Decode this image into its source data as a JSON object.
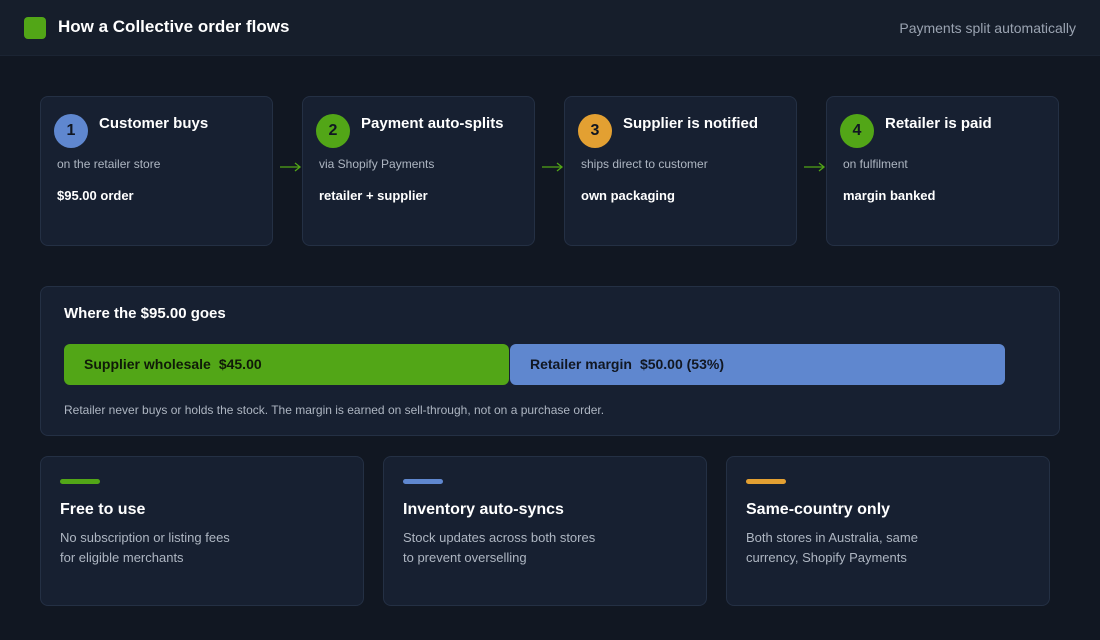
{
  "header": {
    "title": "How a Collective order flows",
    "note": "Payments split automatically",
    "brand_color": "#52a617"
  },
  "steps": [
    {
      "number": "1",
      "title": "Customer buys",
      "subtitle": "on the retailer store",
      "value": "$95.00 order",
      "color": "#5f87cf",
      "number_color": "#111722"
    },
    {
      "number": "2",
      "title": "Payment auto-splits",
      "subtitle": "via Shopify Payments",
      "value": "retailer + supplier",
      "color": "#52a617",
      "number_color": "#111722"
    },
    {
      "number": "3",
      "title": "Supplier is notified",
      "subtitle": "ships direct to customer",
      "value": "own packaging",
      "color": "#e3a032",
      "number_color": "#111722"
    },
    {
      "number": "4",
      "title": "Retailer is paid",
      "subtitle": "on fulfilment",
      "value": "margin banked",
      "color": "#52a617",
      "number_color": "#111722"
    }
  ],
  "arrow_icon": "arrow-right-icon",
  "split": {
    "title": "Where the $95.00 goes",
    "total": 95.0,
    "segments": [
      {
        "label": "Supplier wholesale",
        "value_text": "$45.00",
        "amount": 45.0,
        "color": "#52a617",
        "text_color": "#0f1a08"
      },
      {
        "label": "Retailer margin",
        "value_text": "$50.00 (53%)",
        "amount": 50.0,
        "color": "#5f87cf",
        "text_color": "#111722"
      }
    ],
    "note": "Retailer never buys or holds the stock. The margin is earned on sell-through, not on a purchase order."
  },
  "features": [
    {
      "title": "Free to use",
      "lines": [
        "No subscription or listing fees",
        "for eligible merchants"
      ],
      "color": "#52a617"
    },
    {
      "title": "Inventory auto-syncs",
      "lines": [
        "Stock updates across both stores",
        "to prevent overselling"
      ],
      "color": "#5f87cf"
    },
    {
      "title": "Same-country only",
      "lines": [
        "Both stores in Australia, same",
        "currency, Shopify Payments"
      ],
      "color": "#e3a032"
    }
  ]
}
